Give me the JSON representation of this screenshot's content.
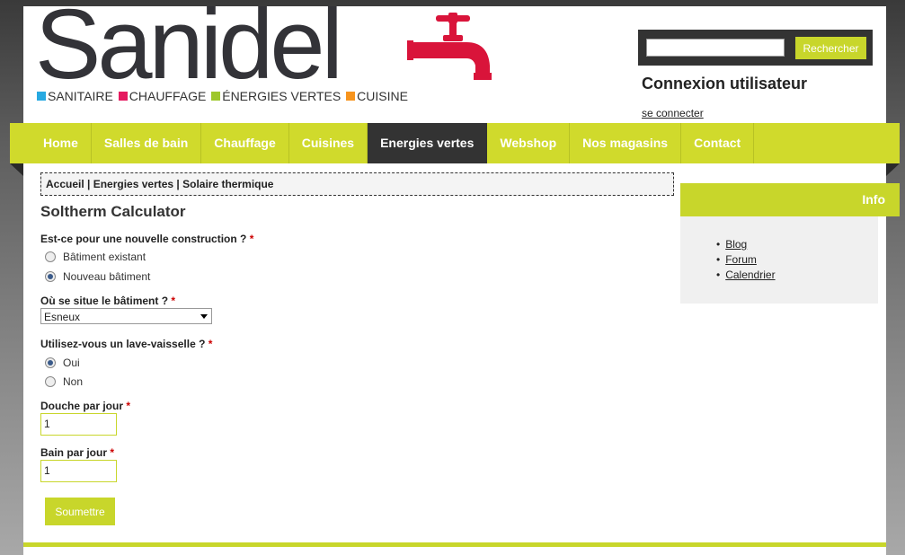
{
  "header": {
    "logo_text": "Sanidel",
    "tagline": [
      {
        "label": "SANITAIRE",
        "color": "#27a9e1"
      },
      {
        "label": "CHAUFFAGE",
        "color": "#e5195f"
      },
      {
        "label": "ÉNERGIES VERTES",
        "color": "#9ec72c"
      },
      {
        "label": "CUISINE",
        "color": "#f7941d"
      }
    ],
    "search_button": "Rechercher",
    "login_title": "Connexion utilisateur",
    "login_link": "se connecter"
  },
  "nav": {
    "items": [
      {
        "label": "Home"
      },
      {
        "label": "Salles de bain"
      },
      {
        "label": "Chauffage"
      },
      {
        "label": "Cuisines"
      },
      {
        "label": "Energies vertes",
        "active": true
      },
      {
        "label": "Webshop"
      },
      {
        "label": "Nos magasins"
      },
      {
        "label": "Contact"
      }
    ]
  },
  "breadcrumb": "Accueil | Energies vertes | Solaire thermique",
  "page_title": "Soltherm Calculator",
  "form": {
    "q1_label": "Est-ce pour une nouvelle construction ?",
    "q1_opt1": "Bâtiment existant",
    "q1_opt2": "Nouveau bâtiment",
    "q2_label": "Où se situe le bâtiment ?",
    "q2_value": "Esneux",
    "q3_label": "Utilisez-vous un lave-vaisselle ?",
    "q3_opt1": "Oui",
    "q3_opt2": "Non",
    "q4_label": "Douche par jour",
    "q4_value": "1",
    "q5_label": "Bain par jour",
    "q5_value": "1",
    "required_mark": "*",
    "submit": "Soumettre"
  },
  "sidebar": {
    "title": "Info",
    "links": [
      "Blog",
      "Forum",
      "Calendrier"
    ]
  },
  "colors": {
    "accent": "#c8d62b",
    "nav_active": "#333333",
    "tap_red": "#d9143a"
  }
}
